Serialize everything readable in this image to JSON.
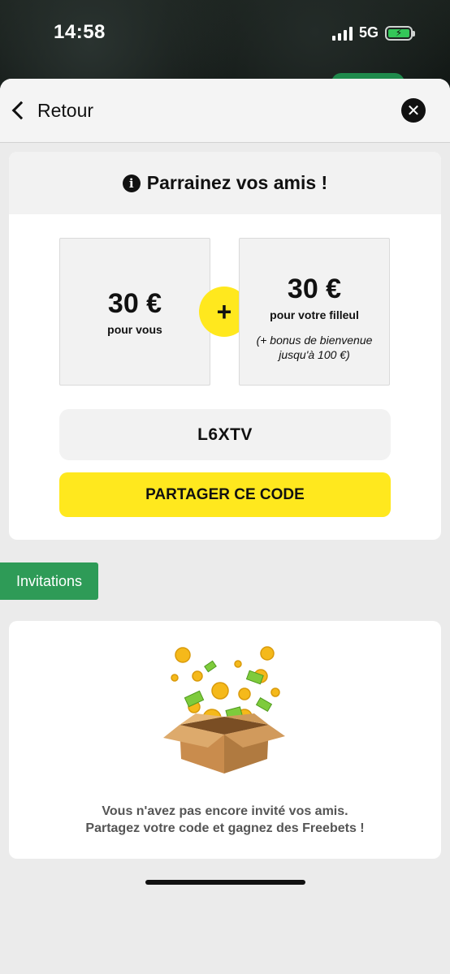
{
  "status_bar": {
    "time": "14:58",
    "network": "5G"
  },
  "nav": {
    "back_label": "Retour"
  },
  "referral": {
    "title": "Parrainez vos amis !",
    "left_amount": "30 €",
    "left_label": "pour vous",
    "plus": "+",
    "right_amount": "30 €",
    "right_label": "pour votre filleul",
    "bonus": "(+ bonus de bienvenue jusqu'à 100 €)",
    "code": "L6XTV",
    "share_label": "PARTAGER CE CODE"
  },
  "invitations": {
    "tab_label": "Invitations",
    "empty_line1": "Vous n'avez pas encore invité vos amis.",
    "empty_line2": "Partagez votre code et gagnez des Freebets !"
  },
  "colors": {
    "accent_yellow": "#ffe81e",
    "accent_green": "#2e9b57"
  },
  "icons": [
    "back-chevron-icon",
    "close-icon",
    "info-icon",
    "plus-icon",
    "gift-box-coins-icon"
  ]
}
